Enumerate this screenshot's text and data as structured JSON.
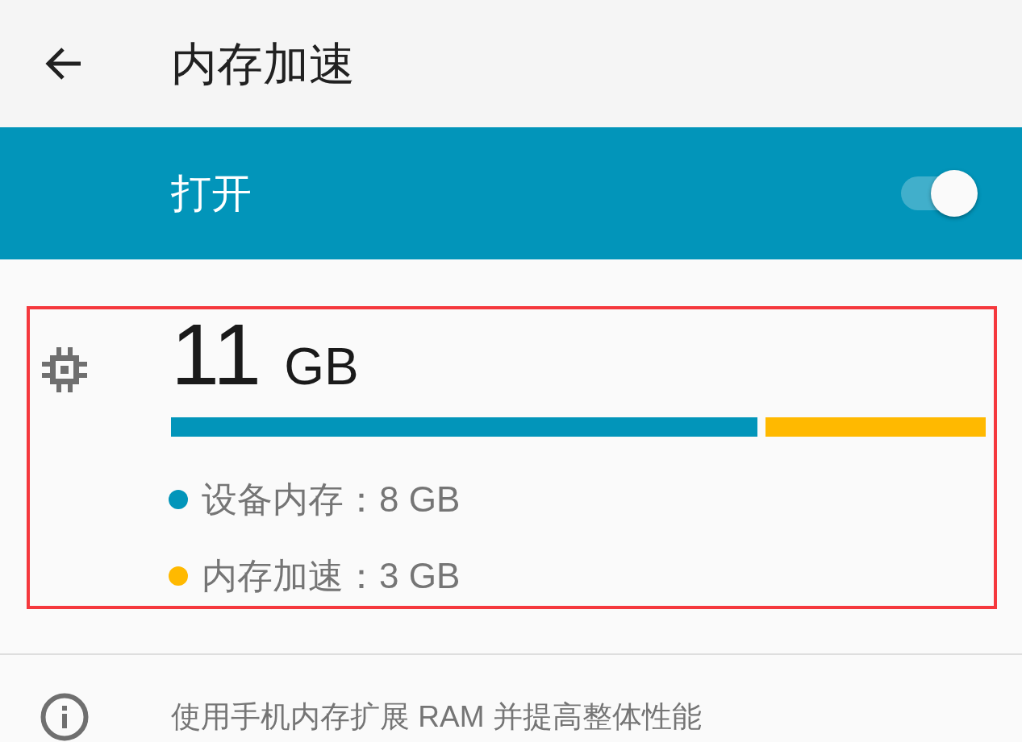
{
  "app_bar": {
    "title": "内存加速"
  },
  "main_switch": {
    "label": "打开",
    "on": true
  },
  "memory": {
    "highlighted": true,
    "total_value": "11",
    "total_unit": "GB",
    "level": 0.72,
    "legend": [
      {
        "label": "设备内存：8 GB",
        "color": "#0295ba"
      },
      {
        "label": "内存加速：3 GB",
        "color": "#ffb900"
      }
    ]
  },
  "info": {
    "text": "使用手机内存扩展 RAM 并提高整体性能"
  }
}
